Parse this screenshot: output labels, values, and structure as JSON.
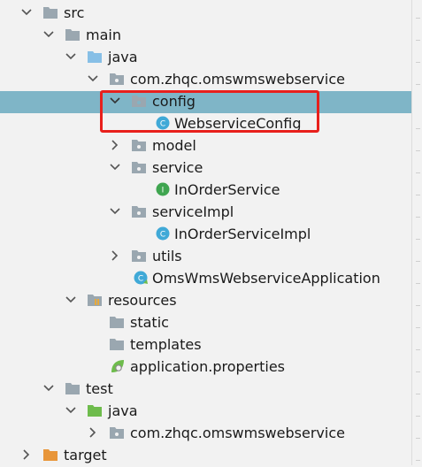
{
  "tree": {
    "rows": [
      {
        "label": "src",
        "kind": "folder",
        "expanded": true
      },
      {
        "label": "main",
        "kind": "folder",
        "expanded": true
      },
      {
        "label": "java",
        "kind": "source-folder",
        "expanded": true
      },
      {
        "label": "com.zhqc.omswmswebservice",
        "kind": "package",
        "expanded": true
      },
      {
        "label": "config",
        "kind": "package",
        "expanded": true,
        "selected": true
      },
      {
        "label": "WebserviceConfig",
        "kind": "class"
      },
      {
        "label": "model",
        "kind": "package",
        "expanded": false
      },
      {
        "label": "service",
        "kind": "package",
        "expanded": true
      },
      {
        "label": "InOrderService",
        "kind": "interface"
      },
      {
        "label": "serviceImpl",
        "kind": "package",
        "expanded": true
      },
      {
        "label": "InOrderServiceImpl",
        "kind": "class"
      },
      {
        "label": "utils",
        "kind": "package",
        "expanded": false
      },
      {
        "label": "OmsWmsWebserviceApplication",
        "kind": "spring-boot-class"
      },
      {
        "label": "resources",
        "kind": "resources-folder",
        "expanded": true
      },
      {
        "label": "static",
        "kind": "folder"
      },
      {
        "label": "templates",
        "kind": "folder"
      },
      {
        "label": "application.properties",
        "kind": "properties-file"
      },
      {
        "label": "test",
        "kind": "folder",
        "expanded": true
      },
      {
        "label": "java",
        "kind": "test-source-folder",
        "expanded": true
      },
      {
        "label": "com.zhqc.omswmswebservice",
        "kind": "package",
        "expanded": false
      },
      {
        "label": "target",
        "kind": "excluded-folder",
        "expanded": false
      }
    ]
  },
  "colors": {
    "selection": "#7fb5c7",
    "highlight_box": "#e8201c",
    "folder": "#9aa7b0",
    "source_folder": "#87bfe6",
    "test_folder": "#6ebc4c",
    "excluded_folder": "#e8963a",
    "class_icon": "#40a9d7",
    "interface_icon": "#3fa550"
  }
}
